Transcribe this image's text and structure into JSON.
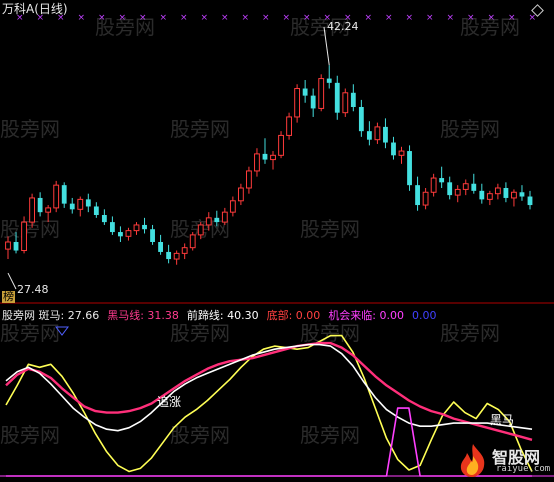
{
  "header": {
    "title": "万科A(日线)",
    "corner_icon": "diamond-icon"
  },
  "watermark": "股旁网",
  "logo": {
    "text": "智股网",
    "url": "raiyue.com"
  },
  "indicator_bar": {
    "items": [
      {
        "label": "股旁网 斑马",
        "value": "27.66",
        "color": "#e8e8e8"
      },
      {
        "label": "黑马线",
        "value": "31.38",
        "color": "#ff3b8e"
      },
      {
        "label": "前蹄线",
        "value": "40.30",
        "color": "#ffffff"
      },
      {
        "label": "底部",
        "value": "0.00",
        "color": "#ff4040"
      },
      {
        "label": "机会来临",
        "value": "0.00",
        "color": "#ff40ff"
      },
      {
        "label": "",
        "value": "0.00",
        "color": "#4040ff"
      }
    ]
  },
  "annotations": {
    "price_high": "42.24",
    "price_low": "27.48",
    "tag_bang": "榜",
    "label_chase": "追涨",
    "label_heima": "黑马"
  },
  "colors": {
    "up": "#ff3b3b",
    "down": "#44e0e0",
    "xmark": "#c040ff",
    "yellow": "#ffff55",
    "pink": "#ff2f7a",
    "white_line": "#ffffff",
    "divider": "#b00000"
  },
  "chart_data": [
    {
      "type": "candlestick",
      "title": "万科A(日线)",
      "ylim": [
        26,
        45
      ],
      "annotations": [
        "42.24",
        "27.48"
      ],
      "candles": [
        [
          29.3,
          30.2,
          28.6,
          29.8
        ],
        [
          29.8,
          30.5,
          29.0,
          29.2
        ],
        [
          29.2,
          31.6,
          29.0,
          31.2
        ],
        [
          31.2,
          33.2,
          30.8,
          32.9
        ],
        [
          32.9,
          33.3,
          31.6,
          31.9
        ],
        [
          31.9,
          32.4,
          31.2,
          32.2
        ],
        [
          32.2,
          34.1,
          31.9,
          33.8
        ],
        [
          33.8,
          34.0,
          32.2,
          32.5
        ],
        [
          32.5,
          32.9,
          31.8,
          32.1
        ],
        [
          32.1,
          33.0,
          31.6,
          32.8
        ],
        [
          32.8,
          33.2,
          31.9,
          32.3
        ],
        [
          32.3,
          32.6,
          31.5,
          31.7
        ],
        [
          31.7,
          32.1,
          31.0,
          31.2
        ],
        [
          31.2,
          31.6,
          30.3,
          30.5
        ],
        [
          30.5,
          30.9,
          29.8,
          30.2
        ],
        [
          30.2,
          30.8,
          29.9,
          30.6
        ],
        [
          30.6,
          31.2,
          30.3,
          31.0
        ],
        [
          31.0,
          31.5,
          30.4,
          30.7
        ],
        [
          30.7,
          31.0,
          29.6,
          29.8
        ],
        [
          29.8,
          30.3,
          28.9,
          29.1
        ],
        [
          29.1,
          29.6,
          28.3,
          28.6
        ],
        [
          28.6,
          29.2,
          28.2,
          29.0
        ],
        [
          29.0,
          29.7,
          28.6,
          29.4
        ],
        [
          29.4,
          30.5,
          29.2,
          30.3
        ],
        [
          30.3,
          31.2,
          30.0,
          31.0
        ],
        [
          31.0,
          31.9,
          30.6,
          31.5
        ],
        [
          31.5,
          32.0,
          30.9,
          31.2
        ],
        [
          31.2,
          32.2,
          31.0,
          31.9
        ],
        [
          31.9,
          33.0,
          31.6,
          32.7
        ],
        [
          32.7,
          33.9,
          32.4,
          33.6
        ],
        [
          33.6,
          35.1,
          33.2,
          34.8
        ],
        [
          34.8,
          36.4,
          34.4,
          36.0
        ],
        [
          36.0,
          37.1,
          35.3,
          35.6
        ],
        [
          35.6,
          36.2,
          34.9,
          35.9
        ],
        [
          35.9,
          37.6,
          35.7,
          37.3
        ],
        [
          37.3,
          38.9,
          37.0,
          38.6
        ],
        [
          38.6,
          40.9,
          38.2,
          40.6
        ],
        [
          40.6,
          41.2,
          39.6,
          40.1
        ],
        [
          40.1,
          40.6,
          38.6,
          39.2
        ],
        [
          39.2,
          41.6,
          39.0,
          41.3
        ],
        [
          41.3,
          42.24,
          40.6,
          41.0
        ],
        [
          41.0,
          41.5,
          38.4,
          38.9
        ],
        [
          38.9,
          40.6,
          38.6,
          40.3
        ],
        [
          40.3,
          40.9,
          39.0,
          39.3
        ],
        [
          39.3,
          39.8,
          37.2,
          37.6
        ],
        [
          37.6,
          38.3,
          36.6,
          37.0
        ],
        [
          37.0,
          38.2,
          36.7,
          37.9
        ],
        [
          37.9,
          38.5,
          36.4,
          36.8
        ],
        [
          36.8,
          37.2,
          35.6,
          35.9
        ],
        [
          35.9,
          36.5,
          35.3,
          36.2
        ],
        [
          36.2,
          36.6,
          33.4,
          33.8
        ],
        [
          33.8,
          34.4,
          32.0,
          32.4
        ],
        [
          32.4,
          33.6,
          32.1,
          33.3
        ],
        [
          33.3,
          34.6,
          33.0,
          34.3
        ],
        [
          34.3,
          35.1,
          33.6,
          34.0
        ],
        [
          34.0,
          34.4,
          32.8,
          33.1
        ],
        [
          33.1,
          33.8,
          32.6,
          33.5
        ],
        [
          33.5,
          34.2,
          33.1,
          33.9
        ],
        [
          33.9,
          34.6,
          33.2,
          33.4
        ],
        [
          33.4,
          33.9,
          32.5,
          32.8
        ],
        [
          32.8,
          33.4,
          32.4,
          33.2
        ],
        [
          33.2,
          33.9,
          32.8,
          33.6
        ],
        [
          33.6,
          34.0,
          32.6,
          32.9
        ],
        [
          32.9,
          33.5,
          32.3,
          33.3
        ],
        [
          33.3,
          33.8,
          32.7,
          33.0
        ],
        [
          33.0,
          33.4,
          32.1,
          32.4
        ]
      ]
    },
    {
      "type": "line",
      "series": [
        {
          "name": "斑马",
          "color": "#ffff55",
          "values": [
            47,
            60,
            74,
            72,
            74,
            66,
            55,
            42,
            28,
            16,
            7,
            3,
            5,
            12,
            22,
            32,
            39,
            44,
            50,
            57,
            64,
            72,
            79,
            84,
            86,
            85,
            84,
            85,
            89,
            93,
            93,
            82,
            65,
            45,
            25,
            11,
            4,
            7,
            24,
            40,
            49,
            42,
            38,
            48,
            44,
            36,
            18,
            3
          ]
        },
        {
          "name": "黑马线",
          "color": "#ff2f7a",
          "values": [
            60,
            67,
            71,
            69,
            65,
            58,
            52,
            46,
            43,
            42,
            42,
            43,
            45,
            48,
            53,
            58,
            63,
            67,
            71,
            74,
            76,
            77,
            78,
            80,
            82,
            84,
            86,
            87,
            88,
            88,
            85,
            80,
            73,
            66,
            60,
            55,
            50,
            46,
            43,
            41,
            38,
            36,
            34,
            32,
            30,
            28,
            26,
            24
          ]
        },
        {
          "name": "前蹄线",
          "color": "#ffffff",
          "values": [
            63,
            69,
            72,
            68,
            61,
            53,
            45,
            39,
            34,
            31,
            30,
            32,
            36,
            42,
            49,
            56,
            61,
            65,
            68,
            71,
            74,
            77,
            80,
            82,
            84,
            85,
            86,
            87,
            87,
            86,
            81,
            73,
            62,
            52,
            44,
            39,
            35,
            33,
            33,
            34,
            35,
            35,
            35,
            35,
            34,
            33,
            32,
            31
          ]
        },
        {
          "name": "机会来临",
          "color": "#ff40ff",
          "values": [
            0,
            0,
            0,
            0,
            0,
            0,
            0,
            0,
            0,
            0,
            0,
            0,
            0,
            0,
            0,
            0,
            0,
            0,
            0,
            0,
            0,
            0,
            0,
            0,
            0,
            0,
            0,
            0,
            0,
            0,
            0,
            0,
            0,
            0,
            0,
            45,
            45,
            0,
            0,
            0,
            0,
            0,
            0,
            0,
            0,
            0,
            0,
            0
          ]
        }
      ]
    }
  ]
}
